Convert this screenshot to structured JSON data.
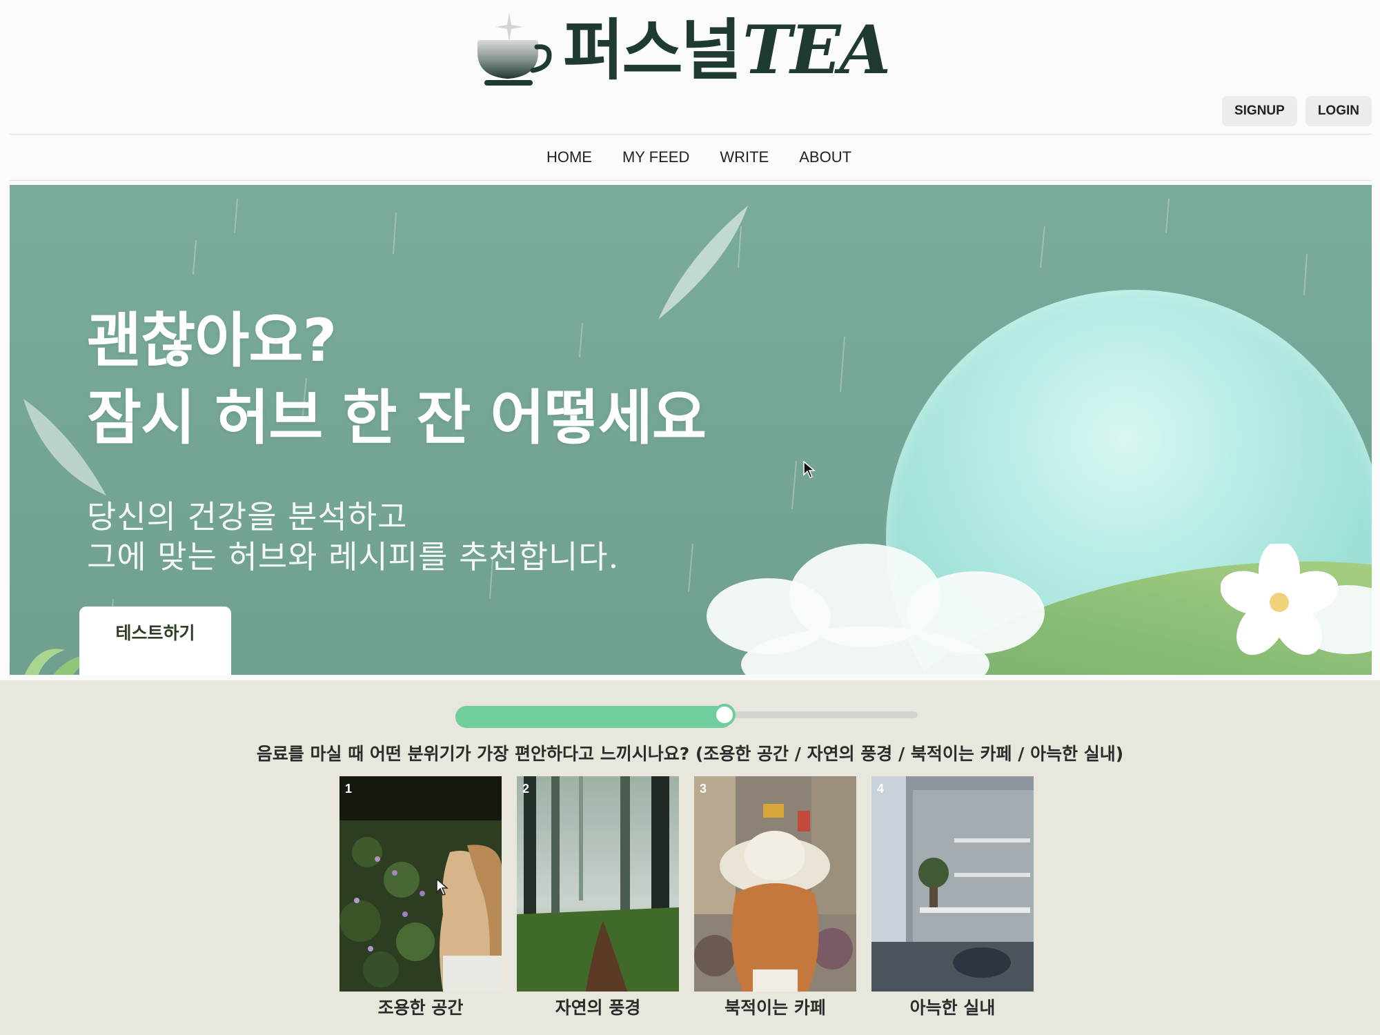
{
  "brand": {
    "name_ko": "퍼스널",
    "name_en": "TEA"
  },
  "auth": {
    "signup": "SIGNUP",
    "login": "LOGIN"
  },
  "nav": [
    {
      "label": "HOME"
    },
    {
      "label": "MY FEED"
    },
    {
      "label": "WRITE"
    },
    {
      "label": "ABOUT"
    }
  ],
  "hero": {
    "title_line1": "괜찮아요?",
    "title_line2": "잠시 허브 한 잔 어떻세요",
    "subtitle_line1": "당신의 건강을 분석하고",
    "subtitle_line2": "그에 맞는 허브와 레시피를 추천합니다.",
    "cta": "테스트하기"
  },
  "quiz": {
    "progress": 0.6,
    "question": "음료를 마실 때 어떤 분위기가 가장 편안하다고 느끼시나요? (조용한 공간 / 자연의 풍경 / 북적이는 카페 / 아늑한 실내)",
    "options": [
      {
        "number": "1",
        "label": "조용한 공간"
      },
      {
        "number": "2",
        "label": "자연의 풍경"
      },
      {
        "number": "3",
        "label": "북적이는 카페"
      },
      {
        "number": "4",
        "label": "아늑한 실내"
      }
    ]
  },
  "colors": {
    "brand_dark": "#1f3a32",
    "hero_bg": "#74a596",
    "accent_green": "#6fce9b",
    "quiz_bg": "#e9e6dd"
  }
}
